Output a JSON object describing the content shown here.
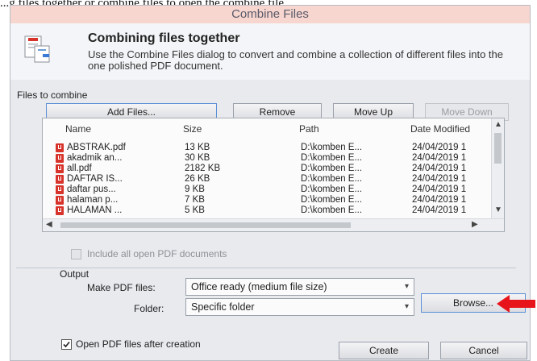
{
  "caption_fragment": "...g files together or combine files to open the combine file...",
  "window": {
    "title": "Combine Files"
  },
  "header": {
    "icon": "combine-files-icon",
    "title": "Combining files together",
    "description": "Use the Combine Files dialog to convert and combine a collection of different files into the one polished PDF document."
  },
  "files_group": {
    "label": "Files to combine",
    "add_label": "Add Files...",
    "remove_label": "Remove",
    "move_up_label": "Move Up",
    "move_down_label": "Move Down"
  },
  "file_table": {
    "columns": [
      "Name",
      "Size",
      "Path",
      "Date Modified"
    ],
    "rows": [
      {
        "name": "ABSTRAK.pdf",
        "size": "13 KB",
        "path": "D:\\komben E...",
        "date": "24/04/2019 1"
      },
      {
        "name": "akadmik an...",
        "size": "30 KB",
        "path": "D:\\komben E...",
        "date": "24/04/2019 1"
      },
      {
        "name": "all.pdf",
        "size": "2182 KB",
        "path": "D:\\komben E...",
        "date": "24/04/2019 1"
      },
      {
        "name": "DAFTAR IS...",
        "size": "26 KB",
        "path": "D:\\komben E...",
        "date": "24/04/2019 1"
      },
      {
        "name": "daftar pus...",
        "size": "9 KB",
        "path": "D:\\komben E...",
        "date": "24/04/2019 1"
      },
      {
        "name": "halaman p...",
        "size": "7 KB",
        "path": "D:\\komben E...",
        "date": "24/04/2019 1"
      },
      {
        "name": "HALAMAN ...",
        "size": "5 KB",
        "path": "D:\\komben E...",
        "date": "24/04/2019 1"
      }
    ]
  },
  "include_open": {
    "label": "Include all open PDF documents",
    "checked": false,
    "disabled": true
  },
  "output": {
    "label": "Output",
    "make_pdf_label": "Make PDF files:",
    "make_pdf_value": "Office ready (medium file size)",
    "folder_label": "Folder:",
    "folder_value": "Specific folder",
    "browse_label": "Browse..."
  },
  "open_after": {
    "label": "Open PDF files after creation",
    "checked": true
  },
  "footer": {
    "create_label": "Create",
    "cancel_label": "Cancel"
  },
  "colors": {
    "annotation_arrow": "#e8141c",
    "title_bar": "#f6d6cf",
    "pdf_icon": "#d8332a"
  }
}
